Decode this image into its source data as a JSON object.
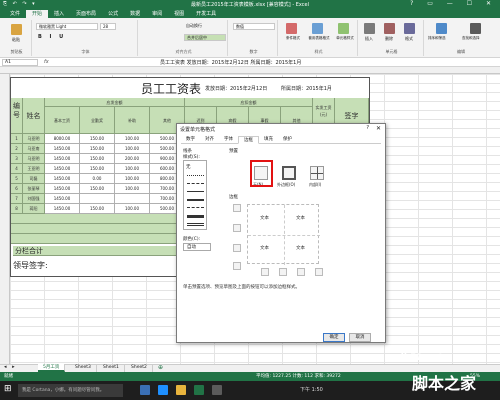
{
  "window": {
    "title": "最新员工2015年工资表模板.xlsx  [兼容模式] - Excel",
    "quick_access": "⎘ ↶ ↷ ▾",
    "controls": "? ▭ — ☐ ✕"
  },
  "ribbon_tabs": [
    "文件",
    "开始",
    "插入",
    "页面布局",
    "公式",
    "数据",
    "审阅",
    "视图",
    "开发工具"
  ],
  "ribbon": {
    "font_name": "微软雅黑 Light",
    "font_size": "28",
    "number_format": "数值",
    "wrap_text": "自动换行",
    "merge_center": "合并后居中",
    "groups": {
      "clipboard": "剪贴板",
      "font": "字体",
      "alignment": "对齐方式",
      "number": "数字",
      "styles": "样式",
      "cells": "单元格",
      "editing": "编辑"
    },
    "buttons": {
      "paste": "粘贴",
      "conditional": "条件格式",
      "table_format": "套用表格格式",
      "cell_style": "单元格样式",
      "insert": "插入",
      "delete": "删除",
      "format": "格式",
      "sort_filter": "排序和筛选",
      "find_select": "查找和选择"
    }
  },
  "formula_bar": {
    "name_box": "A1",
    "fx": "fx",
    "value": "员工工资表   发放日期：2015年2月12日   所属日期：2015年1月"
  },
  "sheet": {
    "title": "员工工资表",
    "issue_date": "发放日期：2015年2月12日",
    "period": "所属日期：2015年1月",
    "header_no": "编号",
    "header_name": "姓名",
    "header_payable": "应发金额",
    "header_deduct": "应扣金额",
    "header_actual": "实发工资(元)",
    "header_sign": "签字",
    "sub_headers": [
      "基本工资",
      "全勤奖",
      "补助",
      "其他",
      "迟到",
      "病假",
      "事假",
      "其他"
    ],
    "rows": [
      {
        "no": "1",
        "name": "马亚明",
        "basic": "8000.00",
        "bonus": "150.00",
        "sub": "100.00",
        "other": "500.00"
      },
      {
        "no": "2",
        "name": "马亚南",
        "basic": "1450.00",
        "bonus": "150.00",
        "sub": "100.00",
        "other": "500.00"
      },
      {
        "no": "3",
        "name": "马亚明",
        "basic": "1450.00",
        "bonus": "150.00",
        "sub": "200.00",
        "other": "900.00"
      },
      {
        "no": "4",
        "name": "王亚明",
        "basic": "1450.00",
        "bonus": "150.00",
        "sub": "100.00",
        "other": "600.00"
      },
      {
        "no": "5",
        "name": "司磊",
        "basic": "1450.00",
        "bonus": "0.00",
        "sub": "100.00",
        "other": "800.00"
      },
      {
        "no": "6",
        "name": "张丽琴",
        "basic": "1450.00",
        "bonus": "150.00",
        "sub": "100.00",
        "other": "700.00"
      },
      {
        "no": "7",
        "name": "刘国强",
        "basic": "1450.00",
        "bonus": "",
        "sub": "",
        "other": "700.00"
      },
      {
        "no": "8",
        "name": "蒋阳",
        "basic": "1450.00",
        "bonus": "150.00",
        "sub": "100.00",
        "other": "500.00"
      }
    ],
    "subtotal": "分栏合计",
    "leader_sign": "领导签字:"
  },
  "dialog": {
    "title": "设置单元格格式",
    "help": "?",
    "close": "✕",
    "tabs": [
      "数字",
      "对齐",
      "字体",
      "边框",
      "填充",
      "保护"
    ],
    "active_tab": "边框",
    "line_section": "线条",
    "style_label": "样式(S):",
    "none_label": "无",
    "color_label": "颜色(C):",
    "color_value": "自动",
    "presets_section": "预置",
    "preset_none": "无(N)",
    "preset_outline": "外边框(O)",
    "preset_inside": "内部(I)",
    "border_section": "边框",
    "preview_text": "文本",
    "hint": "单击预置选项、预览草图及上面的按钮可以添加边框样式。",
    "ok": "确定",
    "cancel": "取消"
  },
  "sheet_tabs": [
    "5月工资",
    "Sheet3",
    "Sheet1",
    "Sheet2"
  ],
  "status": {
    "ready": "就绪",
    "sum": "平均值: 1227.25   计数: 112   求和: 39272",
    "zoom": "55%"
  },
  "taskbar": {
    "search": "我是 Cortana，小娜。有问题尽管问我。",
    "time": "下午 1:50"
  },
  "watermark": {
    "site": "jb51.net",
    "brand": "脚本之家"
  },
  "colors": {
    "excel_green": "#217346",
    "header_fill": "#c6dfb6",
    "highlight": "#e21212"
  }
}
